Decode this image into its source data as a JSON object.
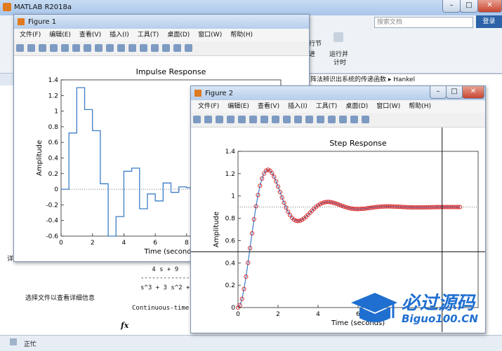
{
  "matlab": {
    "title": "MATLAB R2018a",
    "search_placeholder": "搜索文档",
    "login": "登录",
    "ribbon_labels": [
      "行节",
      "进",
      "运行并",
      "计时"
    ],
    "address_text": "矩阵法辨识出系统的传递函数 ▸ Hankel",
    "left_panel_text": "选择文件以查看详细信息",
    "cmd_lines": [
      "   4 s + 9",
      "---------------",
      "s^3 + 3 s^2 +",
      "Continuous-time"
    ],
    "fx": "fx",
    "status": "正忙",
    "left_tab": "详"
  },
  "figure1": {
    "title": "Figure 1",
    "menu": [
      "文件(F)",
      "编辑(E)",
      "查看(V)",
      "插入(I)",
      "工具(T)",
      "桌面(D)",
      "窗口(W)",
      "帮助(H)"
    ]
  },
  "figure2": {
    "title": "Figure 2",
    "menu": [
      "文件(F)",
      "编辑(E)",
      "查看(V)",
      "插入(I)",
      "工具(T)",
      "桌面(D)",
      "窗口(W)",
      "帮助(H)"
    ]
  },
  "watermark": {
    "cn": "必过源码",
    "en": "Biguo100.CN"
  },
  "chart_data": [
    {
      "type": "line",
      "title": "Impulse Response",
      "xlabel": "Time (seconds)",
      "ylabel": "Amplitude",
      "xlim": [
        0,
        14
      ],
      "ylim": [
        -0.6,
        1.4
      ],
      "yticks": [
        -0.6,
        -0.4,
        -0.2,
        0,
        0.2,
        0.4,
        0.6,
        0.8,
        1,
        1.2,
        1.4
      ],
      "xticks": [
        0,
        2,
        4,
        6,
        8,
        10
      ],
      "series": [
        {
          "style": "stairs",
          "x": [
            0,
            0.5,
            1,
            1.5,
            2,
            2.5,
            3,
            3.5,
            4,
            4.5,
            5,
            5.5,
            6,
            6.5,
            7,
            7.5,
            8,
            8.5,
            9,
            9.5,
            10,
            10.5,
            11
          ],
          "y": [
            0,
            0.72,
            1.3,
            1.02,
            0.75,
            0.07,
            -0.6,
            -0.35,
            0.23,
            0.27,
            -0.25,
            -0.06,
            -0.15,
            0.08,
            -0.04,
            0.03,
            0.02,
            -0.02,
            -0.02,
            0.01,
            0.02,
            0.02,
            0.01
          ]
        }
      ],
      "reference_line": 0
    },
    {
      "type": "line",
      "title": "Step Response",
      "xlabel": "Time (seconds)",
      "ylabel": "Amplitude",
      "xlim": [
        0,
        12
      ],
      "ylim": [
        0,
        1.4
      ],
      "yticks": [
        0,
        0.2,
        0.4,
        0.6,
        0.8,
        1,
        1.2,
        1.4
      ],
      "xticks": [
        0,
        2,
        4,
        6
      ],
      "steady_state": 0.9,
      "crosshair": {
        "x": 10.2,
        "y": 0.5
      },
      "series": [
        {
          "style": "line+circles",
          "model": {
            "final": 0.9,
            "zeta": 0.3,
            "wn": 2.2
          }
        }
      ]
    }
  ]
}
